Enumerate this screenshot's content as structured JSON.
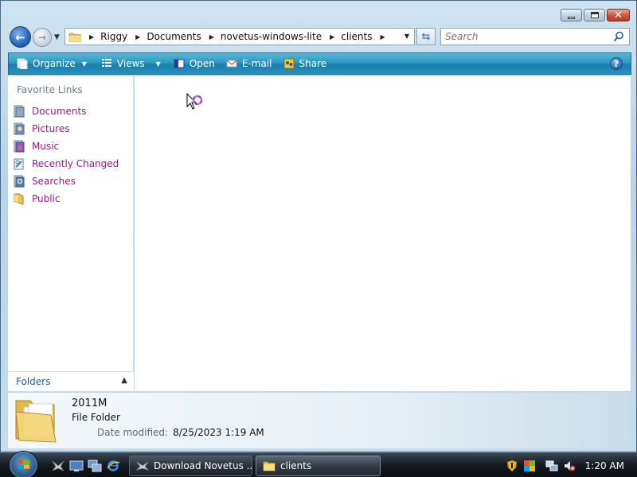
{
  "window": {
    "caption_buttons": {
      "minimize": "minimize",
      "maximize": "restore",
      "close": "✕"
    }
  },
  "address_bar": {
    "breadcrumbs": [
      "Riggy",
      "Documents",
      "novetus-windows-lite",
      "clients"
    ]
  },
  "search": {
    "placeholder": "Search"
  },
  "toolbar": {
    "organize_label": "Organize",
    "views_label": "Views",
    "open_label": "Open",
    "email_label": "E-mail",
    "share_label": "Share",
    "help_label": "?"
  },
  "nav_pane": {
    "title": "Favorite Links",
    "links": [
      {
        "label": "Documents",
        "icon": "documents-icon"
      },
      {
        "label": "Pictures",
        "icon": "pictures-icon"
      },
      {
        "label": "Music",
        "icon": "music-icon"
      },
      {
        "label": "Recently Changed",
        "icon": "recently-changed-icon"
      },
      {
        "label": "Searches",
        "icon": "searches-icon"
      },
      {
        "label": "Public",
        "icon": "public-folder-icon"
      }
    ],
    "folders_label": "Folders"
  },
  "details": {
    "name": "2011M",
    "type": "File Folder",
    "date_label": "Date modified:",
    "date_value": "8/25/2023 1:19 AM"
  },
  "taskbar": {
    "tasks": [
      {
        "label": "Download Novetus ...",
        "icon": "browser-window-icon"
      },
      {
        "label": "clients",
        "icon": "folder-icon"
      }
    ],
    "clock": "1:20 AM"
  },
  "colors": {
    "toolbar": "#2590bb",
    "link": "#a0198a",
    "folders_label": "#1f5da8",
    "taskbar": "#151a20"
  }
}
